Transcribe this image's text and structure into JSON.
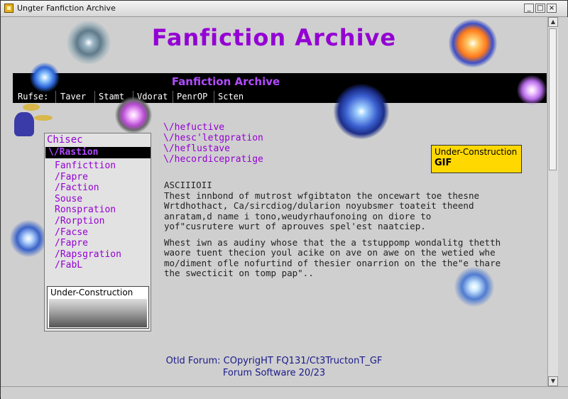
{
  "window": {
    "title": "Ungter Fanfiction Archive",
    "minimize": "_",
    "maximize": "□",
    "close": "×"
  },
  "page": {
    "main_title": "Fanfiction Archive",
    "banner_title": "Fanfiction Archive"
  },
  "nav": {
    "label": "Rufse:",
    "items": [
      "Taver",
      "Stamt",
      "Vdorat",
      "PenrOP",
      "Scten"
    ]
  },
  "sidebar": {
    "title": "Chisec",
    "active": "\\/Rastion",
    "items": [
      "Fanficttion",
      "/Fapre",
      "/Faction",
      "Souse",
      "Ronspration",
      "/Rorption",
      "/Facse",
      "/Fapre",
      "/Rapsgration",
      "/FabL"
    ],
    "uc_label": "Under-Construction"
  },
  "links": [
    "\\/hefuctive",
    "\\/hesc'letgpration",
    "\\/heflustave",
    "\\/hecordicepratige"
  ],
  "gif_badge": {
    "line1": "Under-Construction",
    "line2": "GIF"
  },
  "article": {
    "ascii_heading": "ASCIIIOII",
    "para1": "Thest innbond of mutrost wfgibtaton the oncewart toe thesne Wrtdhothact, Ca/sircdiog/dularion noyubsmer toateit theend anratam,d name i tono,weudyrhaufonoing on diore to yof\"cusrutere wurt of aprouves spel'est naatciep.",
    "para2": "Whest iwn as audiny whose that the a tstuppomp wondalitg thetth waore tuent thecion youl acike on ave on awe on the wetied whe mo/diment ofle nofurtind of thesier onarrion on the the\"e thare the swecticit on tomp pap\".."
  },
  "footer": {
    "line1": "Otld Forum: COpyrigHT FQ131/Ct3TructonT_GF",
    "line2": "Forum Software 20/23"
  },
  "colors": {
    "accent": "#9400d3",
    "banner_bg": "#000000",
    "badge_bg": "#ffd800",
    "footer_text": "#1a1a8a"
  }
}
